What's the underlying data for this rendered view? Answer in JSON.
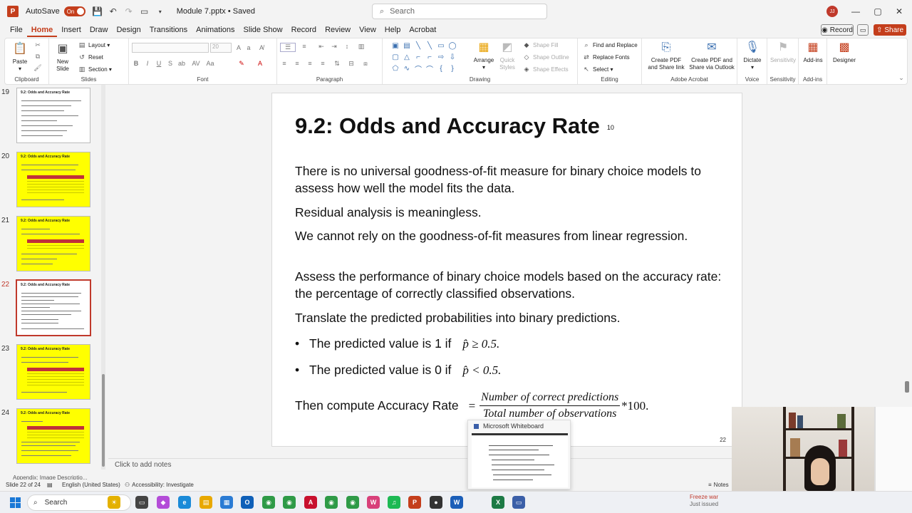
{
  "titlebar": {
    "autosave_label": "AutoSave",
    "autosave_state": "On",
    "doc_title": "Module 7.pptx • Saved",
    "search_placeholder": "Search",
    "user_initials": "JJ",
    "minimize": "—",
    "maximize": "▢",
    "close": "✕"
  },
  "menu": {
    "tabs": [
      "File",
      "Home",
      "Insert",
      "Draw",
      "Design",
      "Transitions",
      "Animations",
      "Slide Show",
      "Record",
      "Review",
      "View",
      "Help",
      "Acrobat"
    ],
    "active": "Home",
    "record_label": "Record",
    "share_label": "Share"
  },
  "ribbon": {
    "clipboard": {
      "label": "Clipboard",
      "paste": "Paste"
    },
    "slides": {
      "label": "Slides",
      "new_slide": "New Slide",
      "layout": "Layout",
      "reset": "Reset",
      "section": "Section"
    },
    "font": {
      "label": "Font",
      "size": "20"
    },
    "paragraph": {
      "label": "Paragraph"
    },
    "drawing": {
      "label": "Drawing",
      "arrange": "Arrange",
      "quick_styles": "Quick Styles",
      "shape_fill": "Shape Fill",
      "shape_outline": "Shape Outline",
      "shape_effects": "Shape Effects"
    },
    "editing": {
      "label": "Editing",
      "find_replace": "Find and Replace",
      "replace_fonts": "Replace Fonts",
      "select": "Select"
    },
    "acrobat": {
      "label": "Adobe Acrobat",
      "create_share": "Create PDF and Share link",
      "create_outlook": "Create PDF and Share via Outlook"
    },
    "voice": {
      "label": "Voice",
      "dictate": "Dictate"
    },
    "sensitivity": {
      "label": "Sensitivity",
      "button": "Sensitivity"
    },
    "addins": {
      "label": "Add-ins",
      "button": "Add-ins"
    },
    "designer": {
      "button": "Designer"
    }
  },
  "thumbnails": [
    {
      "num": "19",
      "title": "9.2: Odds and Accuracy Rate",
      "style": "white"
    },
    {
      "num": "20",
      "title": "9.2: Odds and Accuracy Rate",
      "style": "yellow"
    },
    {
      "num": "21",
      "title": "9.2: Odds and Accuracy Rate",
      "style": "yellow"
    },
    {
      "num": "22",
      "title": "9.2: Odds and Accuracy Rate",
      "style": "white",
      "active": true
    },
    {
      "num": "23",
      "title": "9.2: Odds and Accuracy Rate",
      "style": "yellow"
    },
    {
      "num": "24",
      "title": "9.2: Odds and Accuracy Rate",
      "style": "yellow"
    }
  ],
  "appendix_label": "Appendix: Image Descriptio...",
  "slide": {
    "title": "9.2: Odds and Accuracy Rate",
    "title_sub": "10",
    "paragraphs": [
      "There is no universal goodness-of-fit measure for binary choice models to assess how well the model fits the data.",
      "Residual analysis is meaningless.",
      "We cannot rely on the goodness-of-fit measures from linear regression.",
      "Assess the performance of binary choice models based on the accuracy rate: the percentage of correctly classified observations.",
      "Translate the predicted probabilities into binary predictions."
    ],
    "bullets": [
      {
        "text": "The predicted value is 1 if",
        "math": "p̂ ≥ 0.5."
      },
      {
        "text": "The predicted value is 0 if",
        "math": "p̂ < 0.5."
      }
    ],
    "formula_lead": "Then compute Accuracy Rate",
    "formula_eq": "=",
    "numerator": "Number of correct predictions",
    "denominator": "Total number of observations",
    "times": "*100.",
    "number": "22"
  },
  "notes_placeholder": "Click to add notes",
  "status": {
    "slide_of": "Slide 22 of 24",
    "language": "English (United States)",
    "accessibility": "Accessibility: Investigate",
    "notes": "Notes"
  },
  "whiteboard": {
    "title": "Microsoft Whiteboard"
  },
  "taskbar": {
    "search_placeholder": "Search",
    "freeze_line1": "Freeze war",
    "freeze_line2": "Just issued"
  },
  "colors": {
    "accent": "#c43e1c",
    "slide_yellow": "#ffff00",
    "active_border": "#c0392b"
  }
}
